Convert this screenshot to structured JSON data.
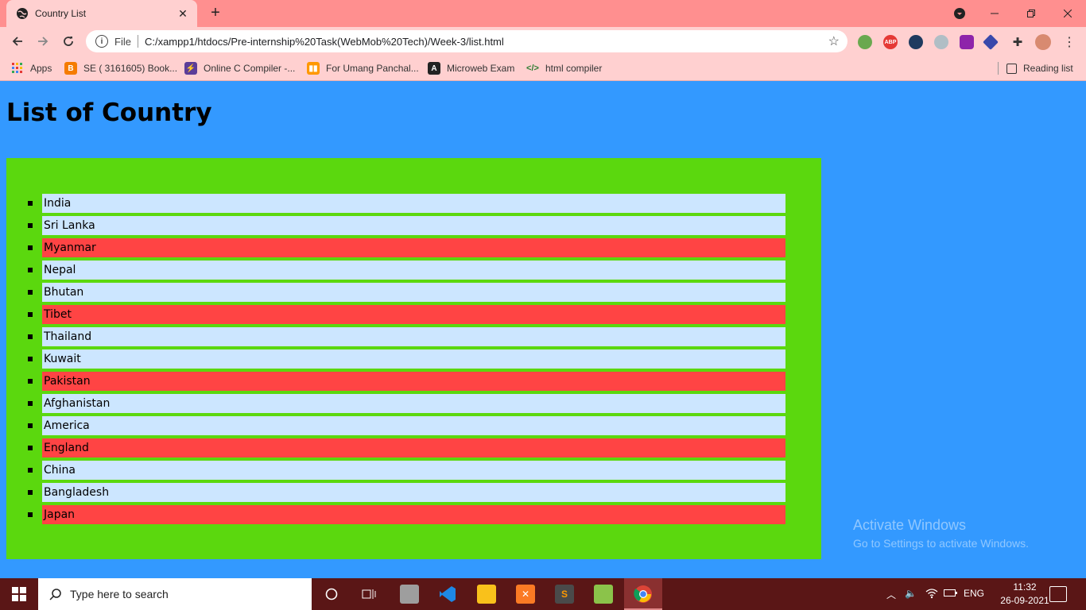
{
  "browser": {
    "tab_title": "Country List",
    "tab_close": "✕",
    "new_tab": "+",
    "url_scheme": "File",
    "url": "C:/xampp1/htdocs/Pre-internship%20Task(WebMob%20Tech)/Week-3/list.html",
    "bookmarks": [
      {
        "label": "Apps",
        "icon": "apps-grid-icon",
        "color": "#e53935"
      },
      {
        "label": "SE ( 3161605) Book...",
        "icon": "blogger-icon",
        "color": "#f57c00"
      },
      {
        "label": "Online C Compiler -...",
        "icon": "compiler-bolt-icon",
        "color": "#5c3d99"
      },
      {
        "label": "For Umang Panchal...",
        "icon": "trello-icon",
        "color": "#ff9800"
      },
      {
        "label": "Microweb Exam",
        "icon": "angular-icon",
        "color": "#222222"
      },
      {
        "label": "html compiler",
        "icon": "code-icon",
        "color": "#2e7d32"
      }
    ],
    "reading_list": "Reading list"
  },
  "page": {
    "heading": "List of Country",
    "countries": [
      {
        "name": "India",
        "highlight": false
      },
      {
        "name": "Sri Lanka",
        "highlight": false
      },
      {
        "name": "Myanmar",
        "highlight": true
      },
      {
        "name": "Nepal",
        "highlight": false
      },
      {
        "name": "Bhutan",
        "highlight": false
      },
      {
        "name": "Tibet",
        "highlight": true
      },
      {
        "name": "Thailand",
        "highlight": false
      },
      {
        "name": "Kuwait",
        "highlight": false
      },
      {
        "name": "Pakistan",
        "highlight": true
      },
      {
        "name": "Afghanistan",
        "highlight": false
      },
      {
        "name": "America",
        "highlight": false
      },
      {
        "name": "England",
        "highlight": true
      },
      {
        "name": "China",
        "highlight": false
      },
      {
        "name": "Bangladesh",
        "highlight": false
      },
      {
        "name": "Japan",
        "highlight": true
      }
    ],
    "colors": {
      "background": "#3399ff",
      "list_box": "#5bd80e",
      "item": "#cce6ff",
      "item_highlight": "#ff4444"
    }
  },
  "watermark": {
    "title": "Activate Windows",
    "subtitle": "Go to Settings to activate Windows."
  },
  "taskbar": {
    "search_placeholder": "Type here to search",
    "language": "ENG",
    "time": "11:32",
    "date": "26-09-2021"
  }
}
